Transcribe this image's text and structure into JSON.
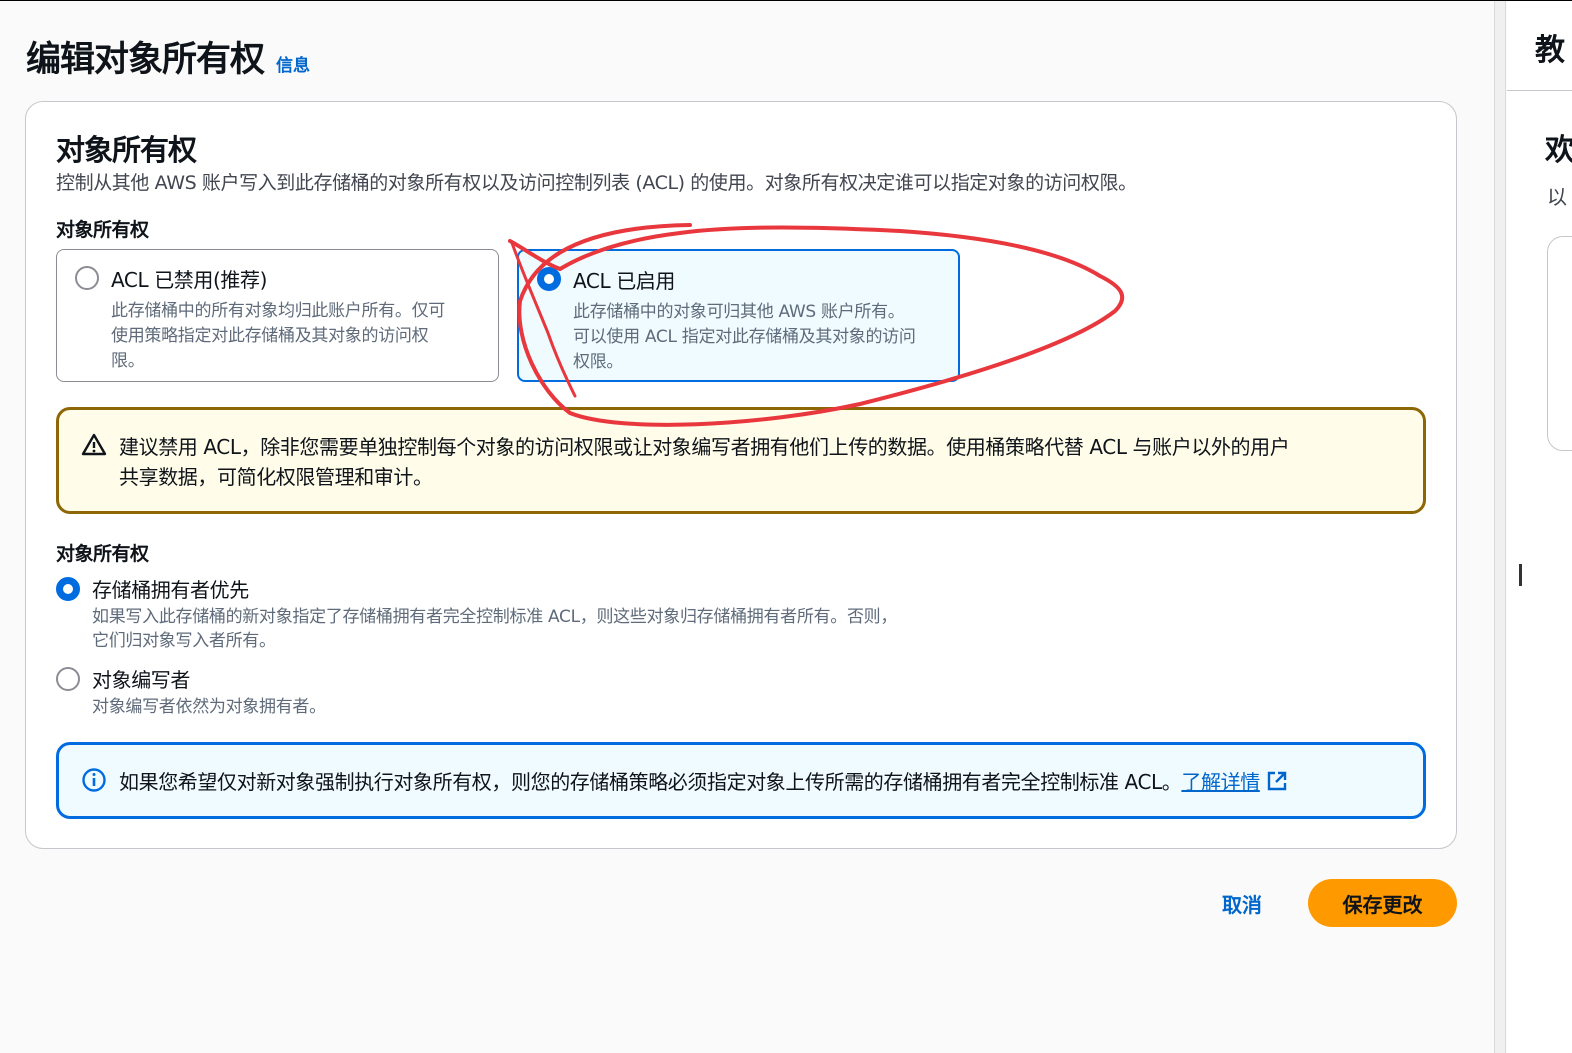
{
  "page": {
    "title": "编辑对象所有权",
    "info_link": "信息"
  },
  "panel": {
    "title": "对象所有权",
    "description": "控制从其他 AWS 账户写入到此存储桶的对象所有权以及访问控制列表 (ACL) 的使用。对象所有权决定谁可以指定对象的访问权限。",
    "field_label": "对象所有权",
    "tiles": [
      {
        "label": "ACL 已禁用(推荐)",
        "description": [
          "此存储桶中的所有对象均归此账户所有。仅可",
          "使用策略指定对此存储桶及其对象的访问权",
          "限。"
        ],
        "selected": false
      },
      {
        "label": "ACL 已启用",
        "description": [
          "此存储桶中的对象可归其他 AWS 账户所有。",
          "可以使用 ACL 指定对此存储桶及其对象的访问",
          "权限。"
        ],
        "selected": true
      }
    ],
    "warning": {
      "icon": "warning-triangle-icon",
      "lines": [
        "建议禁用 ACL，除非您需要单独控制每个对象的访问权限或让对象编写者拥有他们上传的数据。使用桶策略代替 ACL 与账户以外的用户",
        "共享数据，可简化权限管理和审计。"
      ]
    },
    "ownership_label": "对象所有权",
    "options": [
      {
        "label": "存储桶拥有者优先",
        "description": [
          "如果写入此存储桶的新对象指定了存储桶拥有者完全控制标准 ACL，则这些对象归存储桶拥有者所有。否则，",
          "它们归对象写入者所有。"
        ],
        "selected": true
      },
      {
        "label": "对象编写者",
        "description": [
          "对象编写者依然为对象拥有者。"
        ],
        "selected": false
      }
    ],
    "info": {
      "icon": "info-circle-icon",
      "text": "如果您希望仅对新对象强制执行对象所有权，则您的存储桶策略必须指定对象上传所需的存储桶拥有者完全控制标准 ACL。",
      "link": "了解详情",
      "link_icon": "external-link-icon"
    }
  },
  "actions": {
    "cancel": "取消",
    "save": "保存更改"
  },
  "side": {
    "title": "教",
    "heading": "欢",
    "text": "以"
  },
  "colors": {
    "accent": "#006ce0",
    "primary_button": "#ff9900",
    "warning_border": "#8d6605",
    "annotation": "#e8373d"
  }
}
